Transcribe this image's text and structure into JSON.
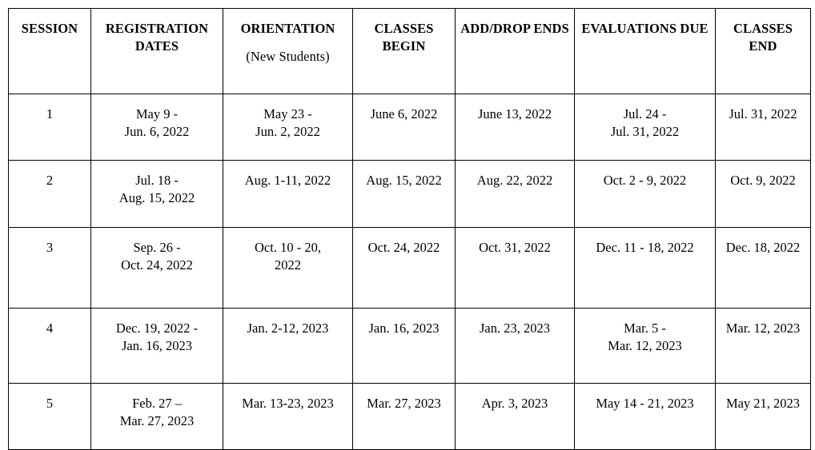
{
  "table": {
    "columns": [
      {
        "key": "session",
        "label": "SESSION",
        "sublabel": ""
      },
      {
        "key": "reg",
        "label": "REGISTRATION DATES",
        "sublabel": ""
      },
      {
        "key": "orient",
        "label": "ORIENTATION",
        "sublabel": "(New Students)"
      },
      {
        "key": "begin",
        "label": "CLASSES BEGIN",
        "sublabel": ""
      },
      {
        "key": "adddrop",
        "label": "ADD/DROP ENDS",
        "sublabel": ""
      },
      {
        "key": "eval",
        "label": "EVALUATIONS DUE",
        "sublabel": ""
      },
      {
        "key": "end",
        "label": "CLASSES END",
        "sublabel": ""
      }
    ],
    "rows": [
      {
        "session": "1",
        "reg_line1": "May 9 -",
        "reg_line2": "Jun. 6, 2022",
        "orient_line1": "May 23 -",
        "orient_line2": "Jun. 2, 2022",
        "begin": "June 6, 2022",
        "adddrop": "June 13, 2022",
        "eval_line1": "Jul. 24 -",
        "eval_line2": "Jul. 31, 2022",
        "end": "Jul. 31, 2022"
      },
      {
        "session": "2",
        "reg_line1": "Jul. 18 -",
        "reg_line2": "Aug. 15, 2022",
        "orient_line1": "Aug. 1-11, 2022",
        "orient_line2": "",
        "begin": "Aug. 15, 2022",
        "adddrop": "Aug. 22, 2022",
        "eval_line1": "Oct. 2 - 9, 2022",
        "eval_line2": "",
        "end": "Oct. 9, 2022"
      },
      {
        "session": "3",
        "reg_line1": "Sep. 26 -",
        "reg_line2": "Oct. 24, 2022",
        "orient_line1": "Oct. 10 - 20,",
        "orient_line2": "2022",
        "begin": "Oct. 24, 2022",
        "adddrop": "Oct. 31, 2022",
        "eval_line1": "Dec. 11 - 18, 2022",
        "eval_line2": "",
        "end": "Dec. 18, 2022"
      },
      {
        "session": "4",
        "reg_line1": "Dec. 19, 2022 -",
        "reg_line2": "Jan. 16, 2023",
        "orient_line1": "Jan. 2-12, 2023",
        "orient_line2": "",
        "begin": "Jan. 16, 2023",
        "adddrop": "Jan. 23, 2023",
        "eval_line1": "Mar. 5 -",
        "eval_line2": "Mar. 12, 2023",
        "end": "Mar. 12, 2023"
      },
      {
        "session": "5",
        "reg_line1": "Feb. 27 –",
        "reg_line2": "Mar. 27, 2023",
        "orient_line1": "Mar. 13-23, 2023",
        "orient_line2": "",
        "begin": "Mar. 27, 2023",
        "adddrop": "Apr. 3, 2023",
        "eval_line1": "May 14 - 21, 2023",
        "eval_line2": "",
        "end": "May 21, 2023"
      }
    ]
  },
  "colors": {
    "border": "#000000",
    "text": "#000000",
    "background": "#ffffff"
  }
}
